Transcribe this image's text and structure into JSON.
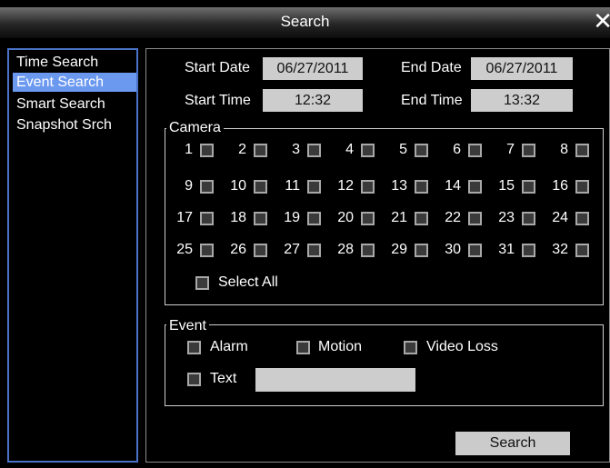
{
  "window": {
    "title": "Search",
    "close_icon": "close-icon"
  },
  "sidebar": {
    "items": [
      {
        "label": "Time Search",
        "selected": false
      },
      {
        "label": "Event Search",
        "selected": true
      },
      {
        "label": "Smart Search",
        "selected": false
      },
      {
        "label": "Snapshot Srch",
        "selected": false
      }
    ]
  },
  "form": {
    "start_date_label": "Start Date",
    "start_date_value": "06/27/2011",
    "end_date_label": "End Date",
    "end_date_value": "06/27/2011",
    "start_time_label": "Start Time",
    "start_time_value": "12:32",
    "end_time_label": "End Time",
    "end_time_value": "13:32"
  },
  "camera": {
    "legend": "Camera",
    "channels": [
      "1",
      "2",
      "3",
      "4",
      "5",
      "6",
      "7",
      "8",
      "9",
      "10",
      "11",
      "12",
      "13",
      "14",
      "15",
      "16",
      "17",
      "18",
      "19",
      "20",
      "21",
      "22",
      "23",
      "24",
      "25",
      "26",
      "27",
      "28",
      "29",
      "30",
      "31",
      "32"
    ],
    "select_all_label": "Select All"
  },
  "event": {
    "legend": "Event",
    "alarm_label": "Alarm",
    "motion_label": "Motion",
    "video_loss_label": "Video Loss",
    "text_label": "Text",
    "text_value": ""
  },
  "actions": {
    "search_label": "Search"
  },
  "colors": {
    "background": "#000000",
    "selection": "#6c99f0",
    "sidebar_border": "#4a72c6",
    "field_bg": "#cdcdcd",
    "checkbox_fill": "#3a3a3a"
  }
}
